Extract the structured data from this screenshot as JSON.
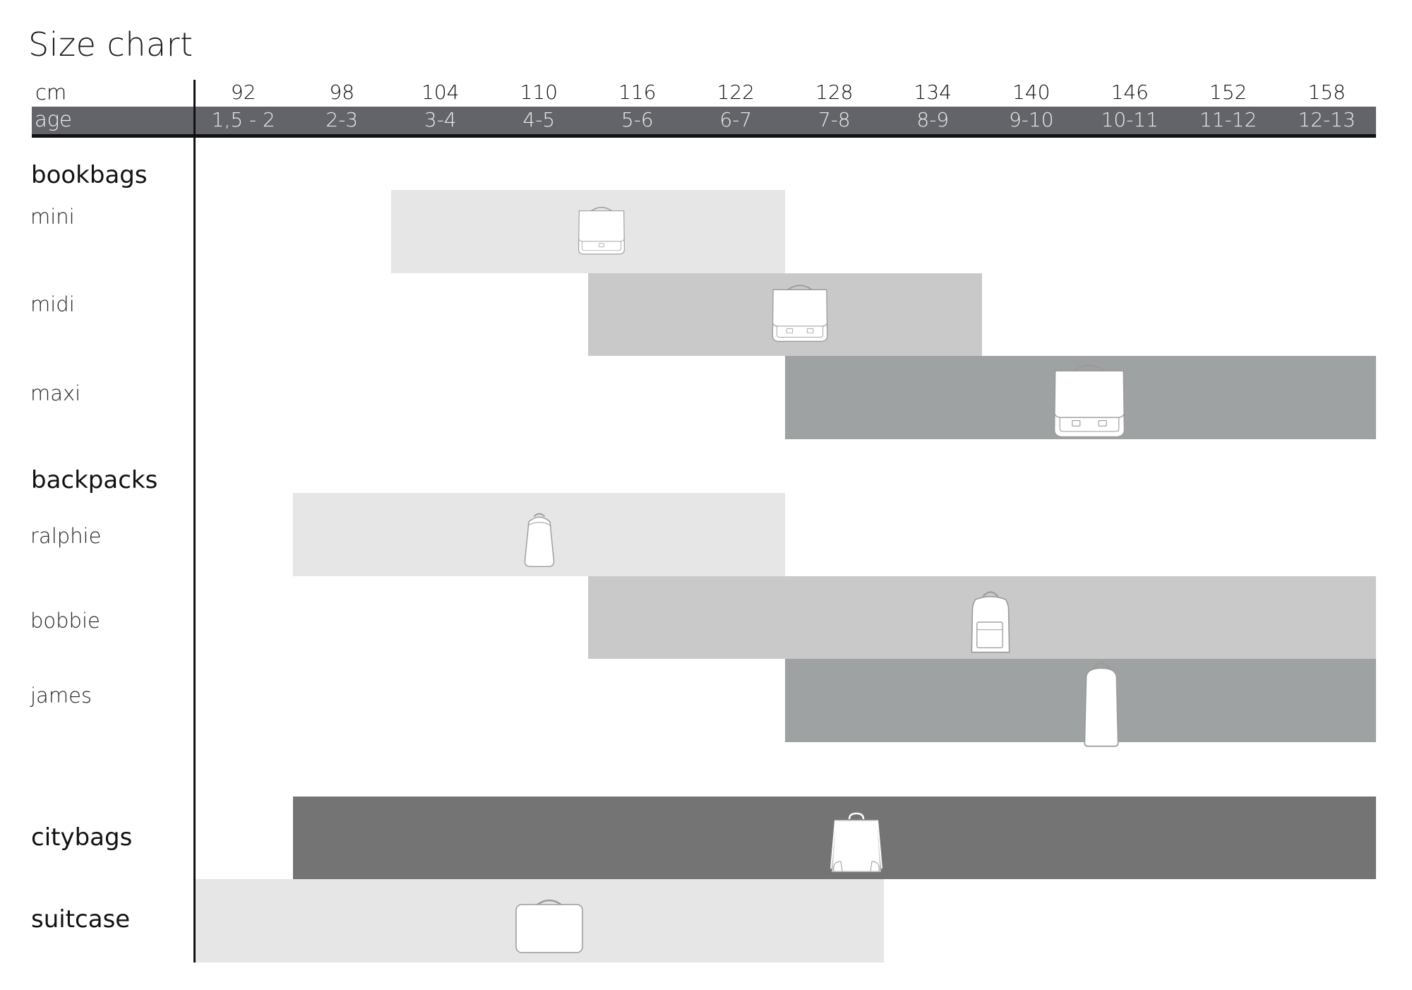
{
  "title": "Size chart",
  "header": {
    "cm_label": "cm",
    "age_label": "age"
  },
  "colors": {
    "age_band": "#636469",
    "header_rule": "#111111",
    "light": "#e6e6e6",
    "mid": "#c9c9c9",
    "dark": "#9fa2a2",
    "darkest": "#737473",
    "icon_fill": "#ffffff",
    "icon_stroke": "#9a9a9a"
  },
  "chart_data": {
    "type": "bar",
    "subtype": "range-gantt",
    "title": "Size chart",
    "x_axis": {
      "label": "cm",
      "secondary_label": "age",
      "categories": [
        "92",
        "98",
        "104",
        "110",
        "116",
        "122",
        "128",
        "134",
        "140",
        "146",
        "152",
        "158"
      ],
      "age_ranges": [
        "1,5 - 2",
        "2-3",
        "3-4",
        "4-5",
        "5-6",
        "6-7",
        "7-8",
        "8-9",
        "9-10",
        "10-11",
        "11-12",
        "12-13"
      ]
    },
    "groups": [
      {
        "name": "bookbags",
        "rows": [
          {
            "name": "mini",
            "from_cm": "104",
            "to_cm": "122",
            "shade": "light",
            "icon": "bookbag-mini-icon"
          },
          {
            "name": "midi",
            "from_cm": "116",
            "to_cm": "134",
            "shade": "mid",
            "icon": "bookbag-midi-icon"
          },
          {
            "name": "maxi",
            "from_cm": "128",
            "to_cm": "158",
            "shade": "dark",
            "icon": "bookbag-maxi-icon"
          }
        ]
      },
      {
        "name": "backpacks",
        "rows": [
          {
            "name": "ralphie",
            "from_cm": "98",
            "to_cm": "122",
            "shade": "light",
            "icon": "backpack-ralphie-icon"
          },
          {
            "name": "bobbie",
            "from_cm": "116",
            "to_cm": "158",
            "shade": "mid",
            "icon": "backpack-bobbie-icon"
          },
          {
            "name": "james",
            "from_cm": "128",
            "to_cm": "158",
            "shade": "dark",
            "icon": "backpack-james-icon"
          }
        ]
      },
      {
        "name": "citybags",
        "rows": [
          {
            "name": "citybags",
            "from_cm": "98",
            "to_cm": "158",
            "shade": "darkest",
            "icon": "citybag-icon"
          }
        ]
      },
      {
        "name": "suitcase",
        "rows": [
          {
            "name": "suitcase",
            "from_cm": "92",
            "to_cm": "128",
            "shade": "light",
            "icon": "suitcase-icon"
          }
        ]
      }
    ],
    "legend": "none",
    "grid": false
  }
}
